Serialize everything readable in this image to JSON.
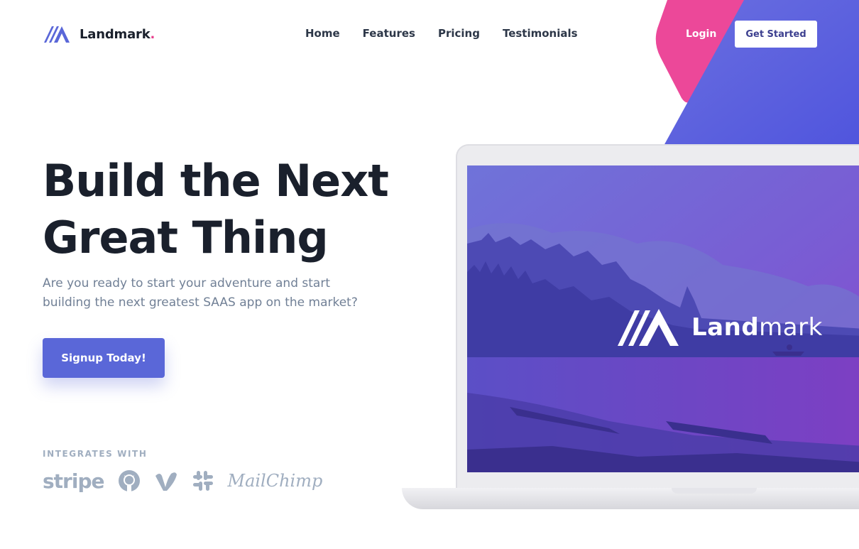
{
  "brand": {
    "name": "Landmark",
    "dot": ".",
    "accent": "#e83e8c",
    "primary": "#5a67d8"
  },
  "nav": {
    "items": [
      "Home",
      "Features",
      "Pricing",
      "Testimonials"
    ]
  },
  "header": {
    "login_label": "Login",
    "cta_label": "Get Started"
  },
  "hero": {
    "title_line1": "Build the Next",
    "title_line2": "Great Thing",
    "subtitle": "Are you ready to start your adventure and start building the next greatest SAAS app on the market?",
    "cta_label": "Signup Today!"
  },
  "integrations": {
    "label": "INTEGRATES WITH",
    "items": [
      {
        "name": "stripe",
        "icon": "stripe-logo"
      },
      {
        "name": "GitHub",
        "icon": "github-icon"
      },
      {
        "name": "Vimeo",
        "icon": "vimeo-icon"
      },
      {
        "name": "Slack",
        "icon": "slack-icon"
      },
      {
        "name": "MailChimp",
        "icon": "mailchimp-logo"
      }
    ]
  },
  "laptop_screen": {
    "logo_bold": "Land",
    "logo_light": "mark"
  }
}
